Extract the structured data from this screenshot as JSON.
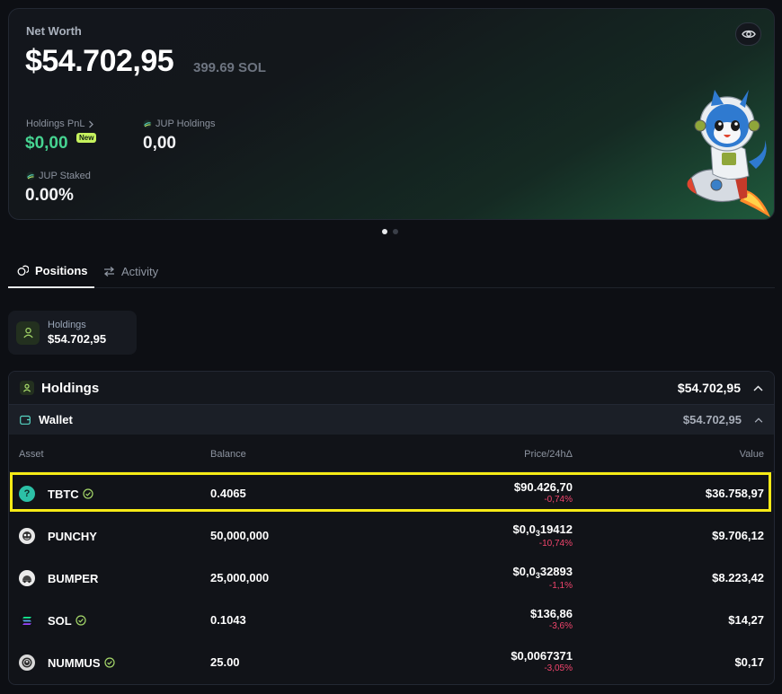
{
  "net_worth": {
    "label": "Net Worth",
    "value": "$54.702,95",
    "sol_value": "399.69 SOL",
    "holdings_pnl_label": "Holdings PnL",
    "holdings_pnl_value": "$0,00",
    "new_badge": "New",
    "jup_holdings_label": "JUP Holdings",
    "jup_holdings_value": "0,00",
    "jup_staked_label": "JUP Staked",
    "jup_staked_value": "0.00%"
  },
  "carousel": {
    "active_index": 0,
    "count": 2
  },
  "tabs": [
    {
      "label": "Positions",
      "active": true
    },
    {
      "label": "Activity",
      "active": false
    }
  ],
  "summary_chip": {
    "label": "Holdings",
    "value": "$54.702,95"
  },
  "holdings": {
    "title": "Holdings",
    "total": "$54.702,95",
    "wallet_label": "Wallet",
    "wallet_total": "$54.702,95",
    "columns": {
      "asset": "Asset",
      "balance": "Balance",
      "price": "Price/24hΔ",
      "value": "Value"
    },
    "rows": [
      {
        "symbol": "TBTC",
        "verified": true,
        "icon": "question-icon",
        "balance": "0.4065",
        "price_prefix": "$90.426,70",
        "price_sub": "",
        "price_rest": "",
        "change": "-0,74%",
        "value": "$36.758,97"
      },
      {
        "symbol": "PUNCHY",
        "verified": false,
        "icon": "punchy-token-icon",
        "balance": "50,000,000",
        "price_prefix": "$0,0",
        "price_sub": "3",
        "price_rest": "19412",
        "change": "-10,74%",
        "value": "$9.706,12"
      },
      {
        "symbol": "BUMPER",
        "verified": false,
        "icon": "bumper-token-icon",
        "balance": "25,000,000",
        "price_prefix": "$0,0",
        "price_sub": "3",
        "price_rest": "32893",
        "change": "-1,1%",
        "value": "$8.223,42"
      },
      {
        "symbol": "SOL",
        "verified": true,
        "icon": "solana-icon",
        "balance": "0.1043",
        "price_prefix": "$136,86",
        "price_sub": "",
        "price_rest": "",
        "change": "-3,6%",
        "value": "$14,27"
      },
      {
        "symbol": "NUMMUS",
        "verified": true,
        "icon": "nummus-token-icon",
        "balance": "25.00",
        "price_prefix": "$0,0067371",
        "price_sub": "",
        "price_rest": "",
        "change": "-3,05%",
        "value": "$0,17"
      }
    ]
  },
  "colors": {
    "accent_green": "#46d391",
    "negative": "#f2456d",
    "highlight": "#f6ea16",
    "badge": "#c6f25e"
  }
}
